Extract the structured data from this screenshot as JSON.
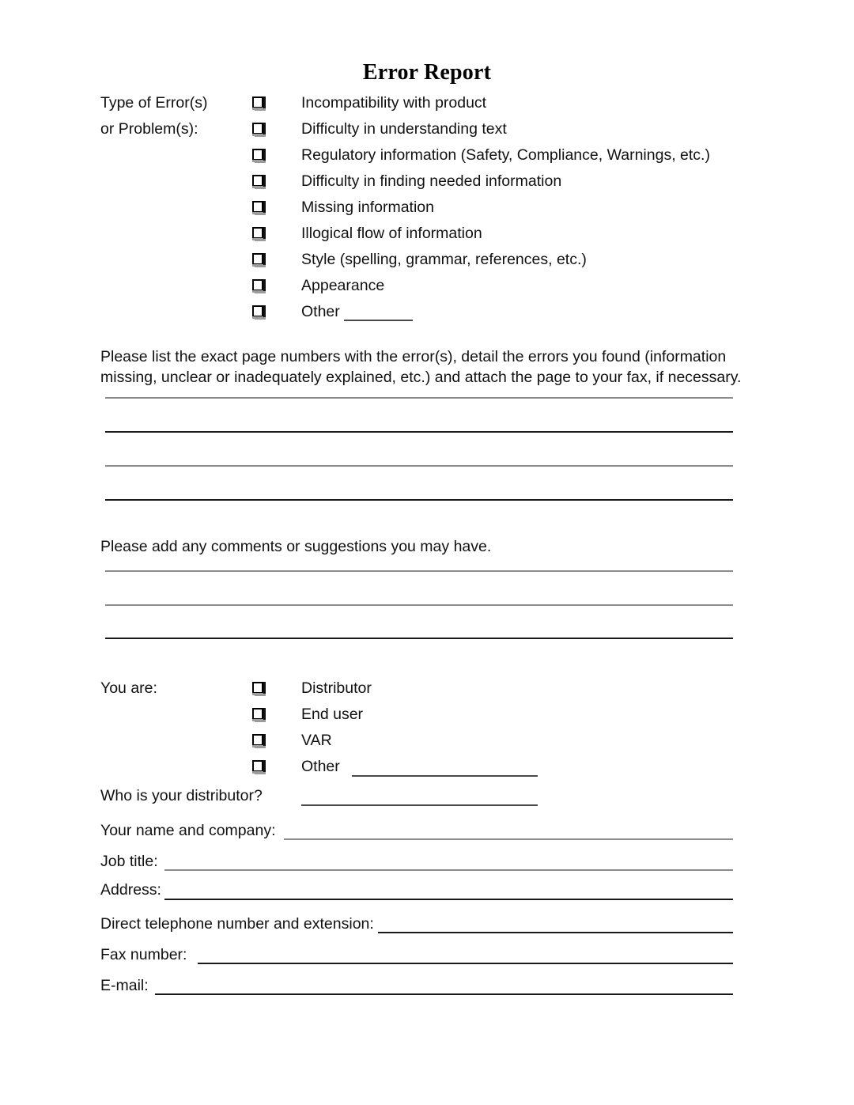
{
  "document": {
    "title": "Error Report"
  },
  "error_section": {
    "label_line1": "Type of Error(s)",
    "label_line2": "or Problem(s):",
    "options": [
      "Incompatibility with product",
      "Difficulty in understanding text",
      "Regulatory information (Safety, Compliance, Warnings, etc.)",
      "Difficulty in finding needed information",
      "Missing information",
      "Illogical flow of information",
      "Style (spelling, grammar, references, etc.)",
      "Appearance",
      "Other"
    ]
  },
  "instructions": {
    "page_numbers": "Please list the exact page numbers with the error(s), detail the errors you found (information missing, unclear or inadequately explained, etc.) and attach the page to your fax, if necessary.",
    "comments": "Please add any comments or suggestions you may have."
  },
  "role_section": {
    "label": "You are:",
    "options": [
      "Distributor",
      "End user",
      "VAR",
      "Other"
    ],
    "distributor_question": "Who is your distributor?"
  },
  "contact_fields": [
    {
      "label": "Your name and company:"
    },
    {
      "label": "Job title:"
    },
    {
      "label": "Address:"
    },
    {
      "label": "Direct telephone number and extension:"
    },
    {
      "label": "Fax number:"
    },
    {
      "label": "E-mail:"
    }
  ],
  "colors": {
    "ink": "#111111",
    "rule_dark": "#1a1a1a",
    "rule_soft": "#8c8c8c",
    "paper": "#ffffff"
  }
}
